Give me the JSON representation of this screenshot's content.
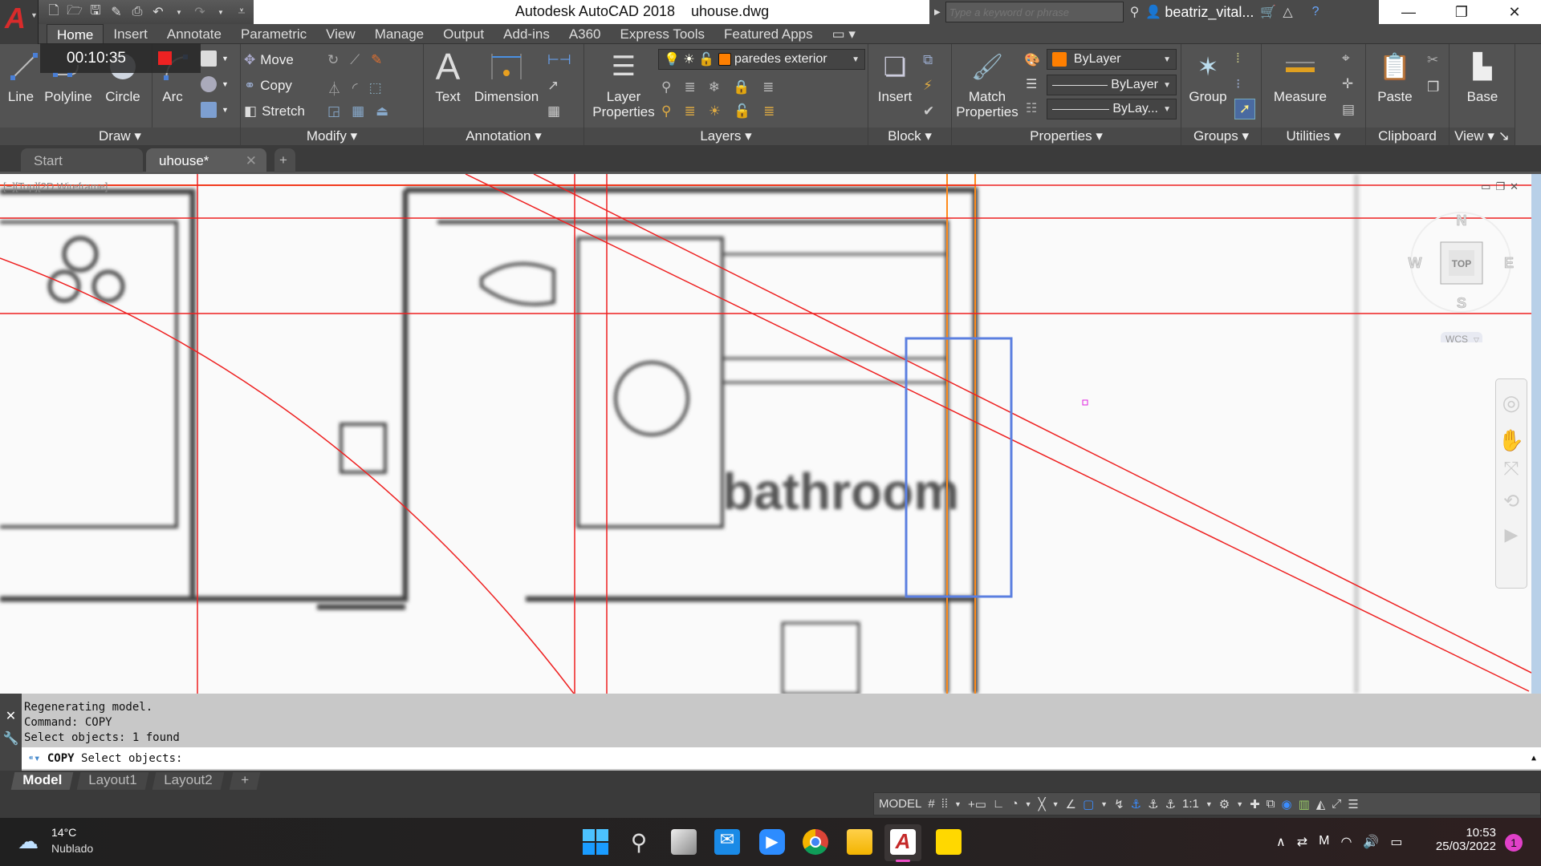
{
  "window": {
    "app_title": "Autodesk AutoCAD 2018",
    "file_name": "uhouse.dwg",
    "search_placeholder": "Type a keyword or phrase",
    "user": "beatriz_vital...",
    "controls": [
      "minimize",
      "restore",
      "close"
    ]
  },
  "quick_access": {
    "items": [
      "new-icon",
      "open-icon",
      "save-icon",
      "save-as-icon",
      "print-icon",
      "undo-icon",
      "redo-icon",
      "customize-icon"
    ]
  },
  "timer": {
    "elapsed": "00:10:35"
  },
  "ribbon_tabs": [
    "Home",
    "Insert",
    "Annotate",
    "Parametric",
    "View",
    "Manage",
    "Output",
    "Add-ins",
    "A360",
    "Express Tools",
    "Featured Apps"
  ],
  "active_ribbon_tab": "Home",
  "ribbon": {
    "draw": {
      "title": "Draw",
      "buttons": [
        "Line",
        "Polyline",
        "Circle",
        "Arc"
      ]
    },
    "modify": {
      "title": "Modify",
      "buttons": [
        "Move",
        "Copy",
        "Stretch"
      ]
    },
    "annotation": {
      "title": "Annotation",
      "buttons": [
        "Text",
        "Dimension"
      ]
    },
    "layers": {
      "title": "Layers",
      "layer_properties": "Layer Properties",
      "current_layer": "paredes exterior",
      "layer_color": "#ff7f00"
    },
    "block": {
      "title": "Block",
      "insert": "Insert"
    },
    "properties": {
      "title": "Properties",
      "match": "Match Properties",
      "color": "ByLayer",
      "color_swatch": "#ff7f00",
      "linetype": "ByLayer",
      "lineweight": "ByLay..."
    },
    "groups": {
      "title": "Groups",
      "group": "Group"
    },
    "utilities": {
      "title": "Utilities",
      "measure": "Measure"
    },
    "clipboard": {
      "title": "Clipboard",
      "paste": "Paste"
    },
    "view": {
      "title": "View",
      "base": "Base"
    }
  },
  "file_tabs": [
    {
      "label": "Start",
      "active": false
    },
    {
      "label": "uhouse*",
      "active": true
    }
  ],
  "viewport": {
    "label": "[−][Top][2D Wireframe]",
    "drawing_text": "bathroom",
    "viewcube": {
      "face": "TOP",
      "north": "N",
      "south": "S",
      "east": "E",
      "west": "W",
      "ucs": "WCS"
    }
  },
  "command_line": {
    "history": [
      "Regenerating model.",
      "Command: COPY",
      "Select objects: 1 found"
    ],
    "prompt_command": "COPY",
    "prompt_text": "Select objects:"
  },
  "layout_tabs": [
    {
      "label": "Model",
      "active": true
    },
    {
      "label": "Layout1",
      "active": false
    },
    {
      "label": "Layout2",
      "active": false
    }
  ],
  "status_bar": {
    "space": "MODEL",
    "annotation_scale": "1:1"
  },
  "taskbar": {
    "weather_temp": "14°C",
    "weather_desc": "Nublado",
    "apps": [
      "start",
      "search",
      "task-view",
      "mail",
      "zoom",
      "chrome",
      "file-explorer",
      "autocad",
      "sticky-notes"
    ],
    "time": "10:53",
    "date": "25/03/2022",
    "notification_count": "1"
  }
}
